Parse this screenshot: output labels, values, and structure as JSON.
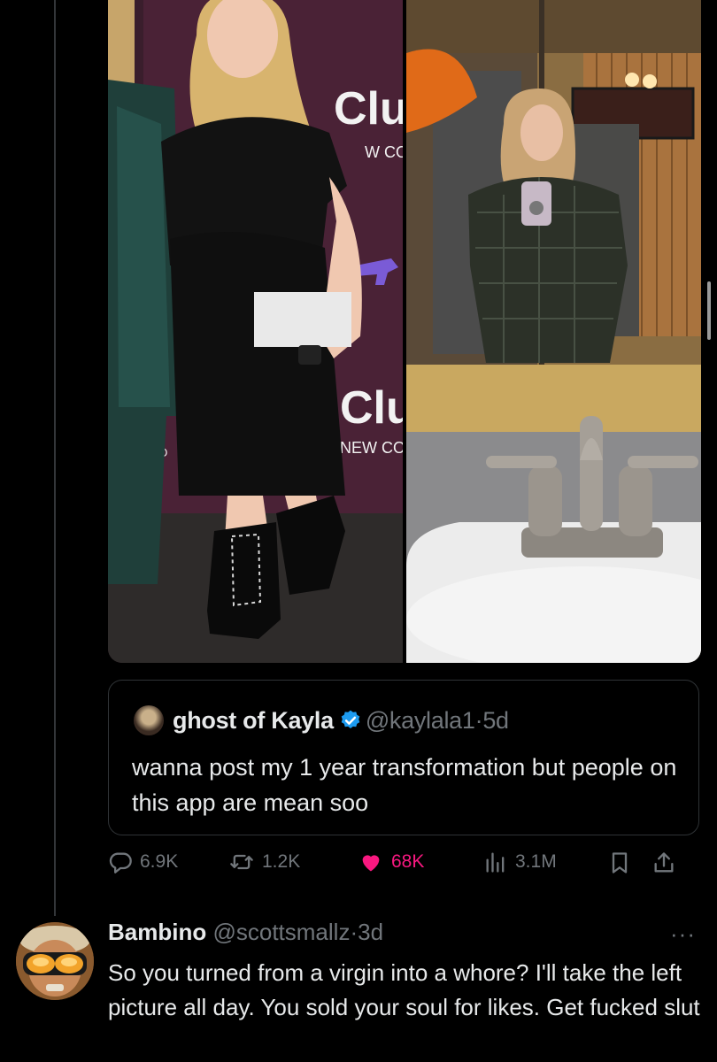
{
  "media": {
    "left_sign_text_1": "Clu",
    "left_sign_text_2": "W CO",
    "left_sign_text_3": "Clu",
    "left_sign_text_4": "NEW COM",
    "left_sign_text_5": "ED"
  },
  "quoted_tweet": {
    "display_name": "ghost of Kayla",
    "handle": "@kaylala1",
    "separator": "·",
    "time": "5d",
    "text": "wanna post my 1 year transformation but people on this app are mean soo",
    "verified": true
  },
  "actions": {
    "replies": "6.9K",
    "reposts": "1.2K",
    "likes": "68K",
    "views": "3.1M",
    "like_color": "#f91880",
    "icons": [
      "reply-icon",
      "repost-icon",
      "heart-icon",
      "views-icon",
      "bookmark-icon",
      "share-icon"
    ]
  },
  "reply": {
    "display_name": "Bambino",
    "handle": "@scottsmallz",
    "separator": "·",
    "time": "3d",
    "more": "···",
    "text": "So you turned from a virgin into a whore? I'll take the left picture all day. You sold your soul for likes. Get fucked slut"
  },
  "colors": {
    "background": "#000000",
    "text": "#e7e9ea",
    "muted": "#71767b",
    "verified": "#1d9bf0",
    "border": "#2f3336"
  }
}
